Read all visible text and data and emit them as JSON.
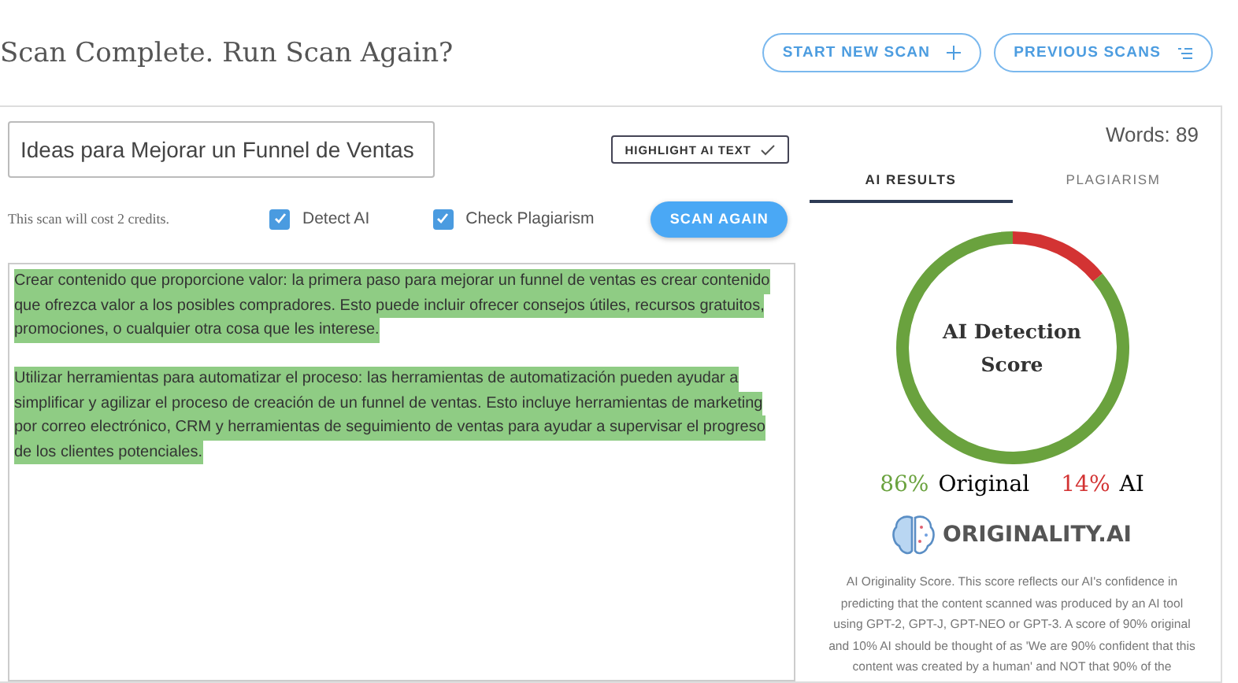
{
  "header": {
    "title": "Scan Complete. Run Scan Again?",
    "buttons": [
      {
        "label": "START NEW SCAN"
      },
      {
        "label": "PREVIOUS SCANS"
      }
    ]
  },
  "scan": {
    "title_value": "Ideas para Mejorar un Funnel de Ventas",
    "highlight_button": "HIGHLIGHT AI TEXT",
    "cost_note": "This scan will cost 2 credits.",
    "options": [
      {
        "label": "Detect AI",
        "checked": true
      },
      {
        "label": "Check Plagiarism",
        "checked": true
      }
    ],
    "scan_button": "SCAN AGAIN"
  },
  "content": [
    {
      "highlighted": true,
      "lines": [
        "Crear contenido que proporcione valor: la primera paso para mejorar un funnel de ventas es crear contenido",
        "que ofrezca valor a los posibles compradores. Esto puede incluir ofrecer consejos útiles, recursos gratuitos,",
        "promociones, o cualquier otra cosa que les interese."
      ]
    },
    {
      "highlighted": true,
      "lines": [
        "Utilizar herramientas para automatizar el proceso: las herramientas de automatización pueden ayudar a",
        "simplificar y agilizar el proceso de creación de un funnel de ventas. Esto incluye herramientas de marketing",
        "por correo electrónico, CRM y herramientas de seguimiento de ventas para ayudar a supervisar el progreso",
        "de los clientes potenciales."
      ]
    }
  ],
  "results": {
    "words": "Words: 89",
    "tabs": [
      {
        "label": "AI RESULTS",
        "selected": true
      },
      {
        "label": "PLAGIARISM",
        "selected": false
      }
    ],
    "chart_data": {
      "type": "donut",
      "title": "AI Detection Score",
      "categories": [
        "Original",
        "AI"
      ],
      "series": [
        {
          "values": [
            86,
            14
          ]
        }
      ]
    },
    "original_pct": "86%",
    "ai_pct": "14%",
    "logo_text": "ORIGINALITY.AI",
    "description": "AI Originality Score. This score reflects our AI's confidence in predicting that the content scanned was produced by an AI tool using GPT-2, GPT-J, GPT-NEO or GPT-3. A score of 90% original and 10% AI should be thought of as 'We are 90% confident that this content was created by a human' and NOT that 90% of the"
  }
}
